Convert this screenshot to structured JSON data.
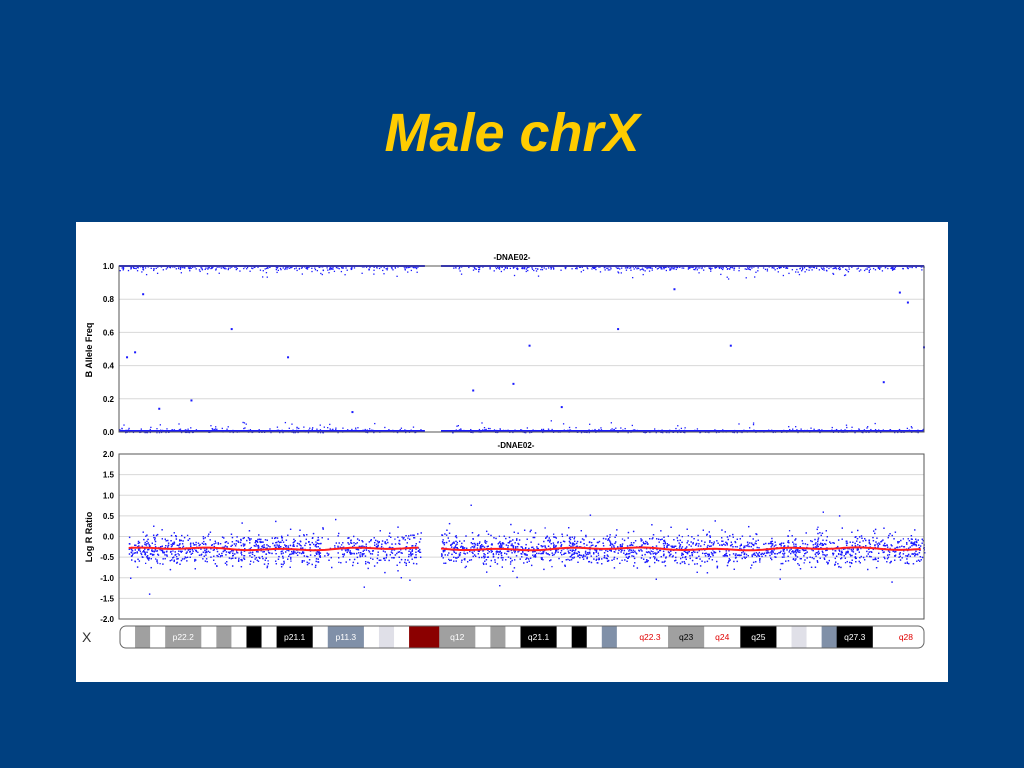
{
  "slide": {
    "title": "Male chrX"
  },
  "colors": {
    "background": "#004080",
    "title": "#FFCC00",
    "points": "#1a1aff",
    "smooth": "#ff2020"
  },
  "chart_data": [
    {
      "type": "scatter",
      "title": "-DNAE02-",
      "xlabel": "",
      "ylabel": "B Allele Freq",
      "ylim": [
        0,
        1.0
      ],
      "yticks": [
        "0.0",
        "0.2",
        "0.4",
        "0.6",
        "0.8",
        "1.0"
      ],
      "grid": true,
      "series": [
        {
          "values_description_only": "dense bands at 0.0 and 1.0 across chromosome X, gap at centromere",
          "bands": [
            0.0,
            1.0
          ],
          "outliers": [
            [
              0.01,
              0.45
            ],
            [
              0.02,
              0.48
            ],
            [
              0.03,
              0.83
            ],
            [
              0.05,
              0.14
            ],
            [
              0.09,
              0.19
            ],
            [
              0.14,
              0.62
            ],
            [
              0.21,
              0.45
            ],
            [
              0.29,
              0.12
            ],
            [
              0.44,
              0.25
            ],
            [
              0.49,
              0.29
            ],
            [
              0.51,
              0.52
            ],
            [
              0.55,
              0.15
            ],
            [
              0.62,
              0.62
            ],
            [
              0.69,
              0.86
            ],
            [
              0.76,
              0.52
            ],
            [
              0.95,
              0.3
            ],
            [
              0.97,
              0.84
            ],
            [
              0.98,
              0.78
            ],
            [
              1.0,
              0.51
            ]
          ]
        }
      ]
    },
    {
      "type": "scatter",
      "title": "-DNAE02-",
      "xlabel": "",
      "ylabel": "Log R Ratio",
      "ylim": [
        -2.0,
        2.0
      ],
      "yticks": [
        "-2.0",
        "-1.5",
        "-1.0",
        "-0.5",
        "0.0",
        "0.5",
        "1.0",
        "1.5",
        "2.0"
      ],
      "grid": true,
      "series": [
        {
          "center": -0.3,
          "smoothed_line": -0.3
        }
      ]
    }
  ],
  "ideogram": {
    "chromosome": "X",
    "bands": [
      {
        "label": "",
        "color": "#ffffff"
      },
      {
        "label": "",
        "color": "#a0a0a0"
      },
      {
        "label": "",
        "color": "#ffffff"
      },
      {
        "label": "p22.2",
        "color": "#a0a0a0",
        "text": "#ffffff"
      },
      {
        "label": "",
        "color": "#ffffff"
      },
      {
        "label": "",
        "color": "#a0a0a0"
      },
      {
        "label": "",
        "color": "#ffffff"
      },
      {
        "label": "",
        "color": "#000000"
      },
      {
        "label": "",
        "color": "#ffffff"
      },
      {
        "label": "p21.1",
        "color": "#000000",
        "text": "#ffffff"
      },
      {
        "label": "",
        "color": "#ffffff"
      },
      {
        "label": "p11.3",
        "color": "#8090a8",
        "text": "#ffffff"
      },
      {
        "label": "",
        "color": "#ffffff"
      },
      {
        "label": "",
        "color": "#e0e0e8"
      },
      {
        "label": "",
        "color": "#ffffff"
      },
      {
        "label": "",
        "color": "#8b0000"
      },
      {
        "label": "",
        "color": "#8b0000"
      },
      {
        "label": "q12",
        "color": "#a0a0a0",
        "text": "#ffffff"
      },
      {
        "label": "",
        "color": "#ffffff"
      },
      {
        "label": "",
        "color": "#a0a0a0"
      },
      {
        "label": "",
        "color": "#ffffff"
      },
      {
        "label": "q21.1",
        "color": "#000000",
        "text": "#ffffff"
      },
      {
        "label": "",
        "color": "#ffffff"
      },
      {
        "label": "",
        "color": "#000000"
      },
      {
        "label": "",
        "color": "#ffffff"
      },
      {
        "label": "",
        "color": "#8090a8"
      },
      {
        "label": "",
        "color": "#ffffff"
      },
      {
        "label": "q22.3",
        "color": "#ffffff",
        "text": "#e00000"
      },
      {
        "label": "q23",
        "color": "#a0a0a0",
        "text": "#000000"
      },
      {
        "label": "q24",
        "color": "#ffffff",
        "text": "#e00000"
      },
      {
        "label": "q25",
        "color": "#000000",
        "text": "#ffffff"
      },
      {
        "label": "",
        "color": "#ffffff"
      },
      {
        "label": "",
        "color": "#e0e0e8"
      },
      {
        "label": "",
        "color": "#ffffff"
      },
      {
        "label": "",
        "color": "#8090a8"
      },
      {
        "label": "q27.3",
        "color": "#000000",
        "text": "#ffffff"
      },
      {
        "label": "",
        "color": "#ffffff"
      },
      {
        "label": "q28",
        "color": "#ffffff",
        "text": "#e00000"
      }
    ]
  }
}
